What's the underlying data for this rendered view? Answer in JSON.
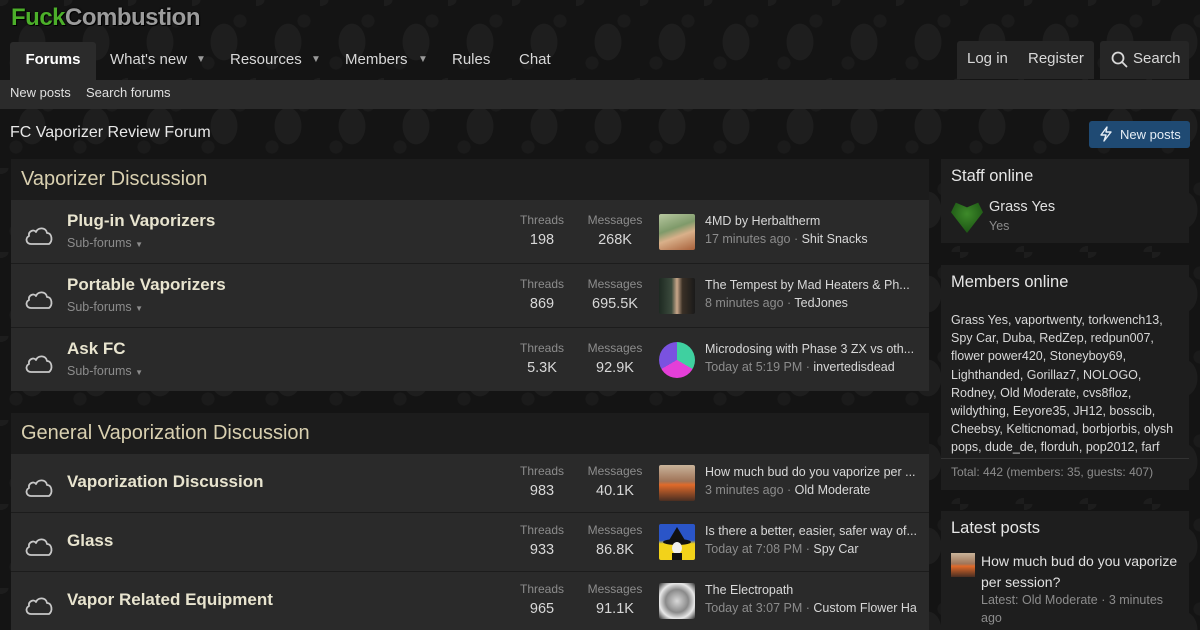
{
  "logo": {
    "part1": "Fuck",
    "part2": "Combustion"
  },
  "nav": {
    "forums": "Forums",
    "whats_new": "What's new",
    "resources": "Resources",
    "members": "Members",
    "rules": "Rules",
    "chat": "Chat",
    "login": "Log in",
    "register": "Register",
    "search": "Search"
  },
  "subnav": {
    "new_posts": "New posts",
    "search_forums": "Search forums"
  },
  "page": {
    "title": "FC Vaporizer Review Forum",
    "new_posts_button": "New posts"
  },
  "labels": {
    "threads": "Threads",
    "messages": "Messages",
    "sub_forums": "Sub-forums"
  },
  "categories": [
    {
      "title": "Vaporizer Discussion",
      "forums": [
        {
          "title": "Plug-in Vaporizers",
          "threads": "198",
          "messages": "268K",
          "latest_title": "4MD by Herbaltherm",
          "latest_time": "17 minutes ago",
          "latest_user": "Shit Snacks"
        },
        {
          "title": "Portable Vaporizers",
          "threads": "869",
          "messages": "695.5K",
          "latest_title": "The Tempest by Mad Heaters & Ph...",
          "latest_time": "8 minutes ago",
          "latest_user": "TedJones"
        },
        {
          "title": "Ask FC",
          "threads": "5.3K",
          "messages": "92.9K",
          "latest_title": "Microdosing with Phase 3 ZX vs oth...",
          "latest_time": "Today at 5:19 PM",
          "latest_user": "invertedisdead"
        }
      ]
    },
    {
      "title": "General Vaporization Discussion",
      "forums": [
        {
          "title": "Vaporization Discussion",
          "threads": "983",
          "messages": "40.1K",
          "latest_title": "How much bud do you vaporize per ...",
          "latest_time": "3 minutes ago",
          "latest_user": "Old Moderate"
        },
        {
          "title": "Glass",
          "threads": "933",
          "messages": "86.8K",
          "latest_title": "Is there a better, easier, safer way of...",
          "latest_time": "Today at 7:08 PM",
          "latest_user": "Spy Car"
        },
        {
          "title": "Vapor Related Equipment",
          "threads": "965",
          "messages": "91.1K",
          "latest_title": "The Electropath",
          "latest_time": "Today at 3:07 PM",
          "latest_user": "Custom Flower Ha"
        }
      ]
    }
  ],
  "sidebar": {
    "staff": {
      "title": "Staff online",
      "name": "Grass Yes",
      "role": "Yes"
    },
    "members_online": {
      "title": "Members online",
      "list": "Grass Yes, vaportwenty, torkwench13, Spy Car, Duba, RedZep, redpun007, flower power420, Stoneyboy69, Lighthanded, Gorillaz7, NOLOGO, Rodney, Old Moderate, cvs8floz, wildything, Eeyore35, JH12, bosscib, Cheebsy, Kelticnomad, borbjorbis, olysh pops, dude_de, florduh, pop2012, farf",
      "total": "Total: 442 (members: 35, guests: 407)"
    },
    "latest": {
      "title": "Latest posts",
      "post_title": "How much bud do you vaporize per session?",
      "meta_line1": "Latest: Old Moderate · 3 minutes",
      "meta_line2": "ago"
    }
  },
  "colors": {
    "accent_button": "#1f4a73",
    "logo_green": "#4caf2a",
    "category_title": "#d9d0b0"
  }
}
